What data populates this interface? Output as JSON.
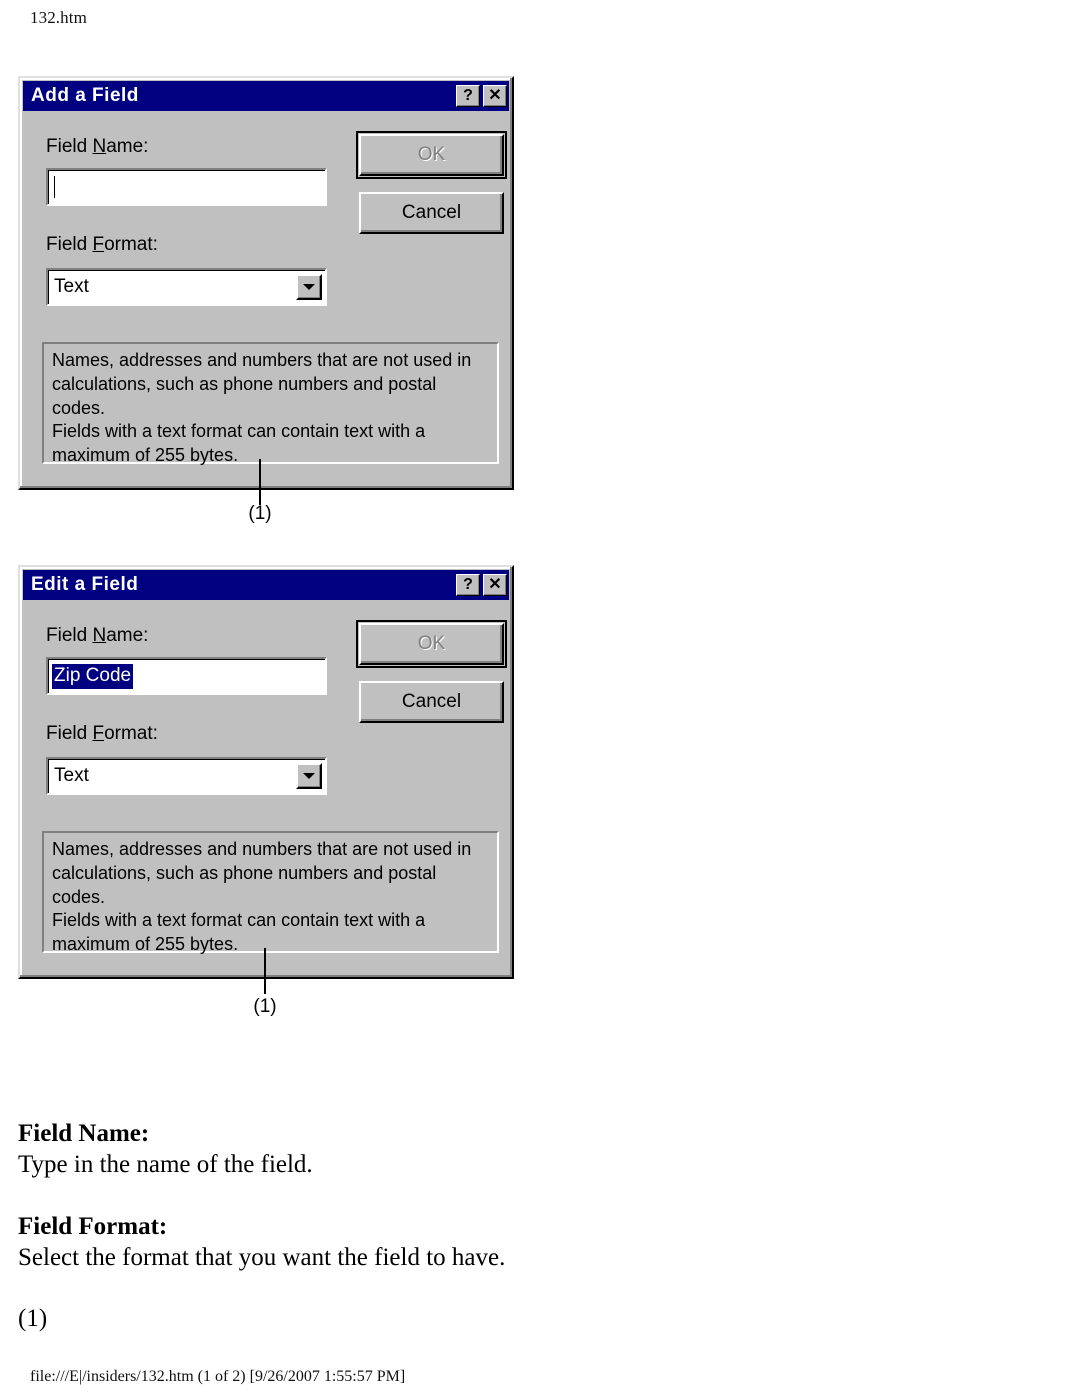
{
  "page": {
    "header_filename": "132.htm",
    "footer": "file:///E|/insiders/132.htm (1 of 2) [9/26/2007 1:55:57 PM]"
  },
  "colors": {
    "titlebar": "#000080",
    "dialog_face": "#c0c0c0",
    "selection": "#000080",
    "selection_text": "#ffffff",
    "disabled_text": "#808080"
  },
  "dialogs": [
    {
      "id": "add-a-field",
      "title": "Add a Field",
      "title_buttons": {
        "help": "?",
        "close": "✕"
      },
      "field_name": {
        "label_pre": "Field ",
        "label_accel": "N",
        "label_post": "ame:",
        "value": "",
        "selected": false
      },
      "field_format": {
        "label_pre": "Field ",
        "label_accel": "F",
        "label_post": "ormat:",
        "value": "Text",
        "options": [
          "Text"
        ]
      },
      "buttons": {
        "ok": "OK",
        "cancel": "Cancel",
        "ok_disabled": true
      },
      "description": "Names, addresses and numbers that are not used in\ncalculations, such as phone numbers and postal\ncodes.\nFields with a text format can contain text with a\nmaximum of 255 bytes.",
      "callout": "(1)"
    },
    {
      "id": "edit-a-field",
      "title": "Edit a Field",
      "title_buttons": {
        "help": "?",
        "close": "✕"
      },
      "field_name": {
        "label_pre": "Field ",
        "label_accel": "N",
        "label_post": "ame:",
        "value": "Zip Code",
        "selected": true
      },
      "field_format": {
        "label_pre": "Field ",
        "label_accel": "F",
        "label_post": "ormat:",
        "value": "Text",
        "options": [
          "Text"
        ]
      },
      "buttons": {
        "ok": "OK",
        "cancel": "Cancel",
        "ok_disabled": true
      },
      "description": "Names, addresses and numbers that are not used in\ncalculations, such as phone numbers and postal\ncodes.\nFields with a text format can contain text with a\nmaximum of 255 bytes.",
      "callout": "(1)"
    }
  ],
  "prose": {
    "field_name_heading": "Field Name:",
    "field_name_text": "Type in the name of the field.",
    "field_format_heading": "Field Format:",
    "field_format_text": "Select the format that you want the field to have.",
    "note_marker": "(1)"
  }
}
